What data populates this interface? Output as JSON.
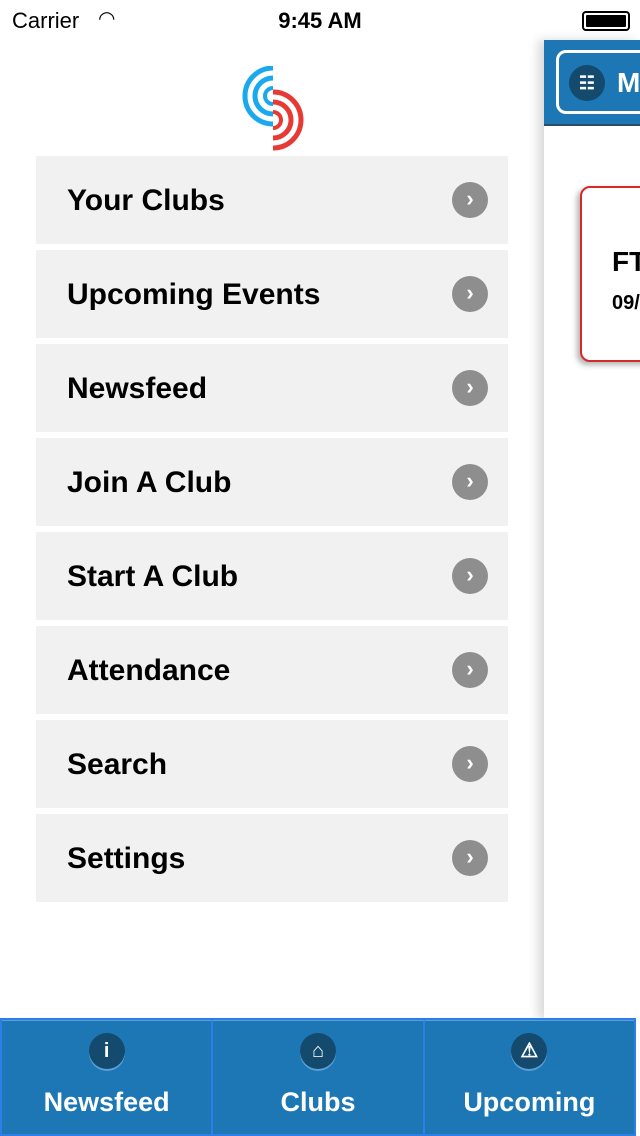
{
  "status": {
    "carrier": "Carrier",
    "time": "9:45 AM"
  },
  "right_panel": {
    "menu_button": "M",
    "card_title": "FT",
    "card_date": "09/"
  },
  "menu": {
    "items": [
      {
        "label": "Your Clubs"
      },
      {
        "label": "Upcoming Events"
      },
      {
        "label": "Newsfeed"
      },
      {
        "label": "Join A Club"
      },
      {
        "label": "Start A Club"
      },
      {
        "label": "Attendance"
      },
      {
        "label": "Search"
      },
      {
        "label": "Settings"
      }
    ]
  },
  "tabbar": {
    "tabs": [
      {
        "label": "Newsfeed",
        "icon": "info-icon"
      },
      {
        "label": "Clubs",
        "icon": "home-icon"
      },
      {
        "label": "Upcoming",
        "icon": "warning-icon"
      }
    ]
  },
  "colors": {
    "accent": "#1c77b4",
    "card_border": "#d42a2a",
    "logo_blue": "#1aa9ef",
    "logo_red": "#e83a35"
  }
}
